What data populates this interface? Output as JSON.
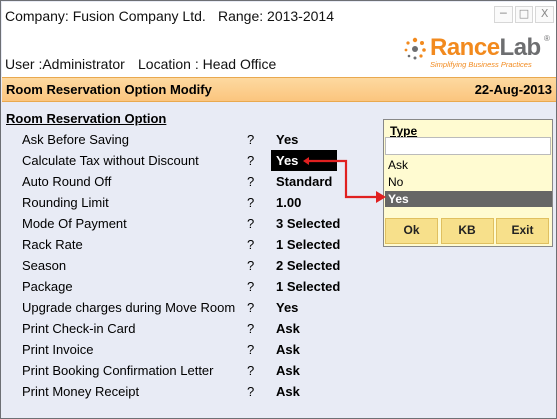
{
  "header": {
    "company": "Company: Fusion Company Ltd.",
    "range": "Range: 2013-2014",
    "user": "User :Administrator",
    "location": "Location : Head Office"
  },
  "window_controls": {
    "minimize": "─",
    "maximize": "□",
    "close": "X"
  },
  "logo": {
    "brand_part1": "Rance",
    "brand_part2": "Lab",
    "registered": "®",
    "tagline": "Simplifying Business Practices"
  },
  "title_bar": {
    "title": "Room Reservation Option Modify",
    "date": "22-Aug-2013"
  },
  "section_title": "Room Reservation Option",
  "options": [
    {
      "label": "Ask Before Saving",
      "q": "?",
      "value": "Yes"
    },
    {
      "label": "Calculate Tax without Discount",
      "q": "?",
      "value": "Yes"
    },
    {
      "label": "Auto Round Off",
      "q": "?",
      "value": "Standard"
    },
    {
      "label": "Rounding Limit",
      "q": "?",
      "value": "1.00"
    },
    {
      "label": "Mode Of Payment",
      "q": "?",
      "value": "3 Selected"
    },
    {
      "label": "Rack Rate",
      "q": "?",
      "value": "1 Selected"
    },
    {
      "label": "Season",
      "q": "?",
      "value": "2 Selected"
    },
    {
      "label": "Package",
      "q": "?",
      "value": "1 Selected"
    },
    {
      "label": "Upgrade charges during Move Room",
      "q": "?",
      "value": "Yes"
    },
    {
      "label": "Print Check-in Card",
      "q": "?",
      "value": "Ask"
    },
    {
      "label": "Print Invoice",
      "q": "?",
      "value": "Ask"
    },
    {
      "label": "Print Booking Confirmation Letter",
      "q": "?",
      "value": "Ask"
    },
    {
      "label": "Print Money Receipt",
      "q": "?",
      "value": "Ask"
    }
  ],
  "type_popup": {
    "header": "Type",
    "input_value": "",
    "options": [
      "Ask",
      "No",
      "Yes"
    ],
    "selected": "Yes",
    "buttons": {
      "ok": "Ok",
      "kb": "KB",
      "exit": "Exit"
    }
  },
  "colors": {
    "arrow": "#e02020",
    "title_bar": "#fbc57e",
    "popup_bg": "#fffbd1",
    "selected_option": "#666666"
  }
}
